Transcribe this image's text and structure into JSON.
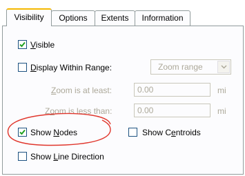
{
  "tabs": [
    {
      "label": "Visibility",
      "active": true
    },
    {
      "label": "Options",
      "active": false
    },
    {
      "label": "Extents",
      "active": false
    },
    {
      "label": "Information",
      "active": false
    }
  ],
  "visibility": {
    "visible": {
      "pre": "",
      "key": "V",
      "post": "isible",
      "checked": true
    },
    "display_range": {
      "pre": "",
      "key": "D",
      "post": "isplay Within Range:",
      "checked": false
    },
    "zoom_combo": {
      "value": "Zoom range"
    },
    "zoom_at_least": {
      "pre": "",
      "key": "Z",
      "post": "oom is at least:",
      "value": "0.00",
      "unit": "mi"
    },
    "zoom_less_than": {
      "pre": "Z",
      "key": "o",
      "post": "om is less than:",
      "value": "0.00",
      "unit": "mi"
    },
    "show_nodes": {
      "pre": "Show ",
      "key": "N",
      "post": "odes",
      "checked": true
    },
    "show_centroids": {
      "pre": "Show C",
      "key": "e",
      "post": "ntroids",
      "checked": false
    },
    "show_line_direction": {
      "pre": "Show ",
      "key": "L",
      "post": "ine Direction",
      "checked": false
    }
  },
  "colors": {
    "annotation": "#e0352b",
    "check": "#21a121",
    "tab_highlight": "#f5b800"
  }
}
